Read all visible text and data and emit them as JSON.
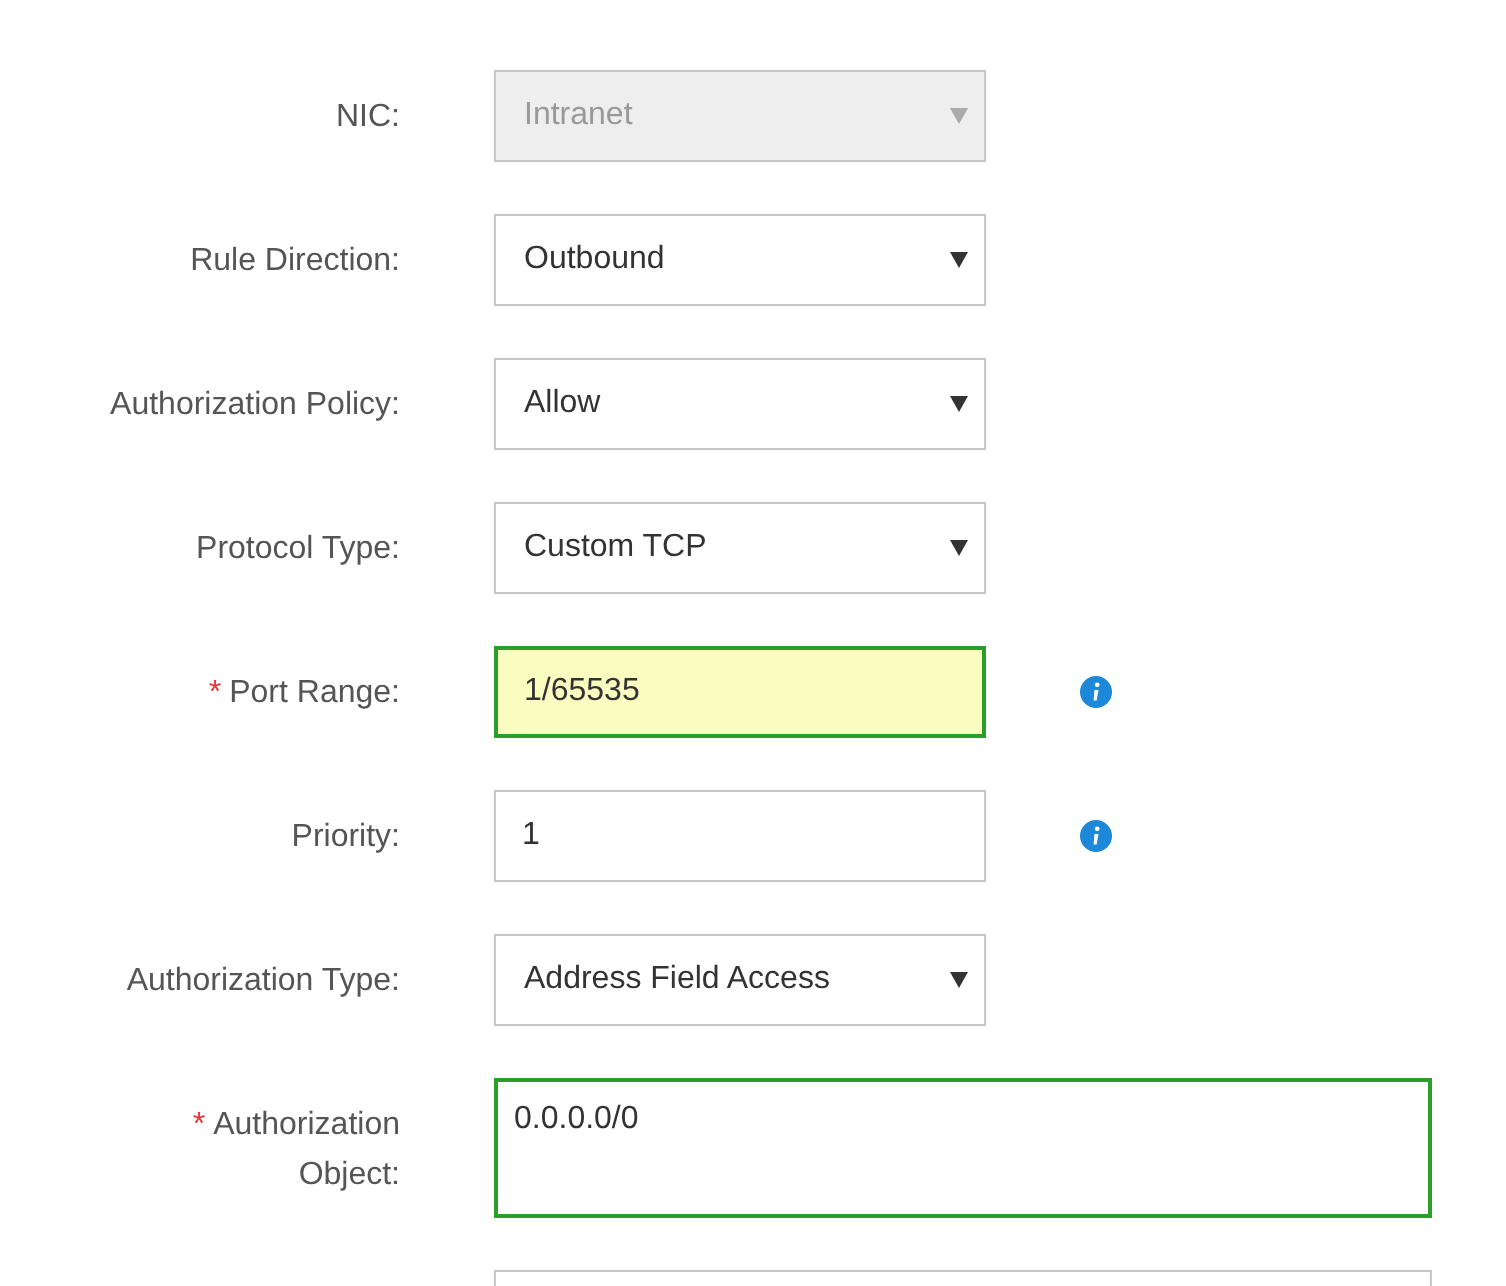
{
  "form": [
    {
      "label": "NIC:",
      "kind": "select",
      "value": "Intranet",
      "disabled": true,
      "validated": false,
      "autofill": false,
      "info": false
    },
    {
      "label": "Rule Direction:",
      "kind": "select",
      "value": "Outbound",
      "disabled": false,
      "validated": false,
      "autofill": false,
      "info": false
    },
    {
      "label": "Authorization Policy:",
      "kind": "select",
      "value": "Allow",
      "disabled": false,
      "validated": false,
      "autofill": false,
      "info": false
    },
    {
      "label": "Protocol Type:",
      "kind": "select",
      "value": "Custom TCP",
      "disabled": false,
      "validated": false,
      "autofill": false,
      "info": false
    },
    {
      "required_mark": "*",
      "label": "Port Range:",
      "kind": "input",
      "value": "1/65535",
      "disabled": false,
      "validated": true,
      "autofill": true,
      "info": true
    },
    {
      "label": "Priority:",
      "kind": "input",
      "value": "1",
      "disabled": false,
      "validated": false,
      "autofill": false,
      "info": true
    },
    {
      "label": "Authorization Type:",
      "kind": "select",
      "value": "Address Field Access",
      "disabled": false,
      "validated": false,
      "autofill": false,
      "info": false
    },
    {
      "required_mark": "*",
      "label": "Authorization Object:",
      "kind": "textarea",
      "value": "0.0.0.0/0",
      "disabled": false,
      "validated": true,
      "autofill": false,
      "info": false
    }
  ]
}
